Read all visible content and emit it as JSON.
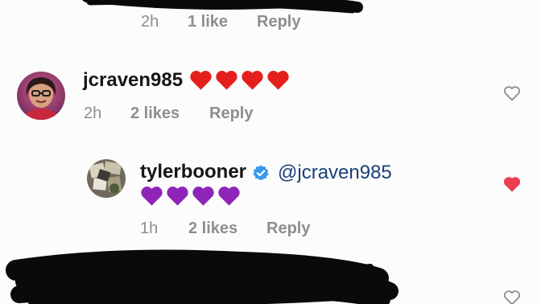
{
  "top_comment": {
    "time": "2h",
    "likes": "1 like",
    "reply": "Reply"
  },
  "comment_jcraven": {
    "username": "jcraven985",
    "emoji": "red-heart x4",
    "time": "2h",
    "likes": "2 likes",
    "reply": "Reply",
    "like_icon": "heart-outline-icon"
  },
  "comment_tyler": {
    "username": "tylerbooner",
    "verified_icon": "verified-badge-icon",
    "mention": "@jcraven985",
    "emoji": "purple-heart x4",
    "time": "1h",
    "likes": "2 likes",
    "reply": "Reply",
    "like_icon": "heart-filled-icon",
    "liked": true
  },
  "bottom_comment": {
    "like_icon": "heart-outline-icon"
  },
  "colors": {
    "red_heart": "#e5201c",
    "purple_heart": "#8e24b8",
    "liked_heart": "#ed3d52",
    "mention": "#1b3f74",
    "verified": "#3897f0",
    "meta_gray": "#8e8e8e",
    "redaction": "#0a0a0a"
  }
}
